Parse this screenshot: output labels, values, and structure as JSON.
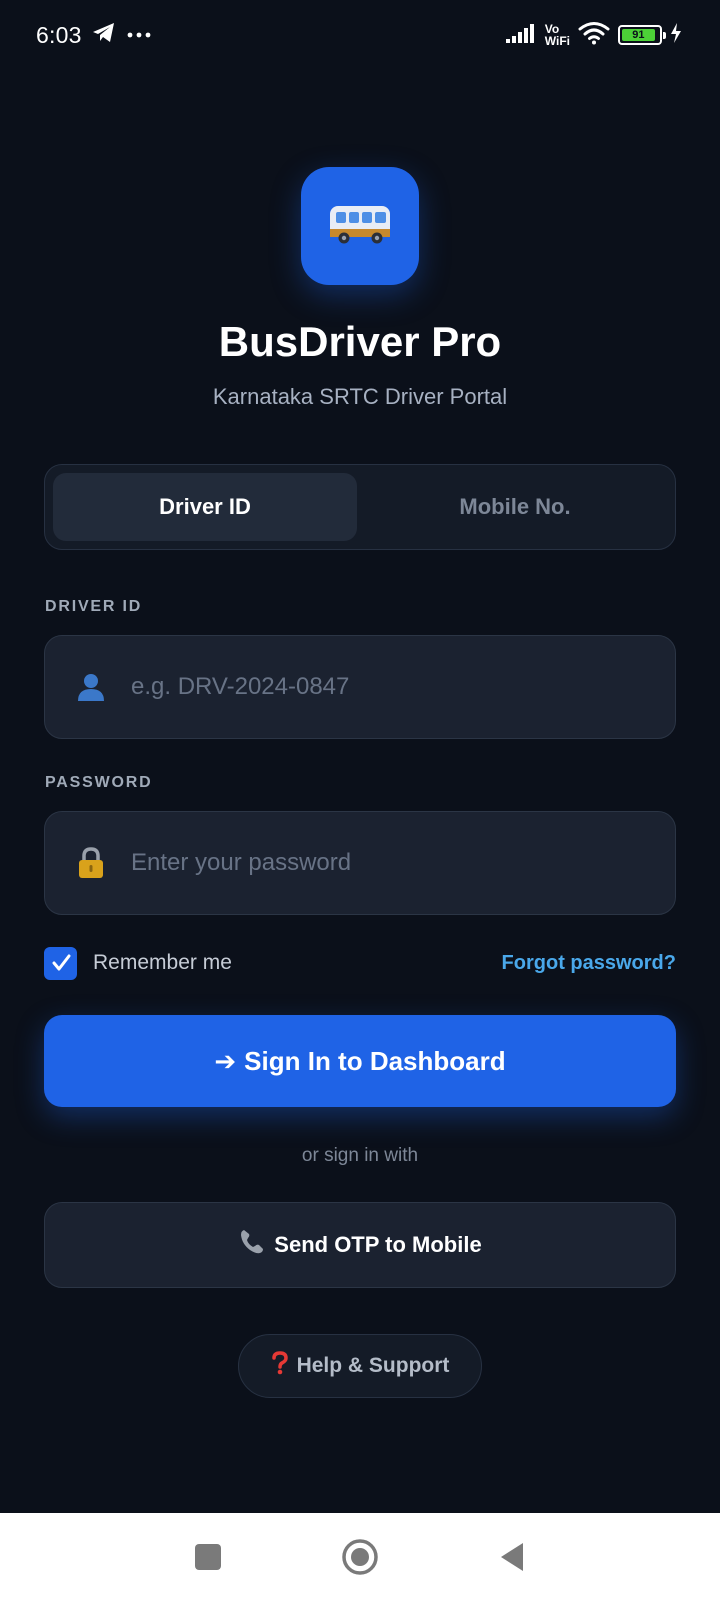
{
  "status_bar": {
    "time": "6:03",
    "battery_level": "91",
    "vowifi_top": "Vo",
    "vowifi_bottom": "WiFi"
  },
  "app": {
    "title": "BusDriver Pro",
    "subtitle": "Karnataka SRTC Driver Portal",
    "logo_icon": "bus-icon",
    "accent_color": "#1f63e6"
  },
  "tabs": [
    {
      "label": "Driver ID",
      "active": true
    },
    {
      "label": "Mobile No.",
      "active": false
    }
  ],
  "form": {
    "driver_id": {
      "label": "DRIVER ID",
      "placeholder": "e.g. DRV-2024-0847",
      "value": "",
      "icon": "user-icon"
    },
    "password": {
      "label": "PASSWORD",
      "placeholder": "Enter your password",
      "value": "",
      "icon": "lock-icon"
    },
    "remember_label": "Remember me",
    "remember_checked": true,
    "forgot_link": "Forgot password?"
  },
  "actions": {
    "sign_in_arrow": "➔",
    "sign_in_text": "Sign In to Dashboard",
    "divider": "or sign in with",
    "otp_text": "Send OTP to Mobile",
    "help_text": "Help & Support"
  },
  "nav": {
    "recents": "recents-icon",
    "home": "home-icon",
    "back": "back-icon"
  }
}
